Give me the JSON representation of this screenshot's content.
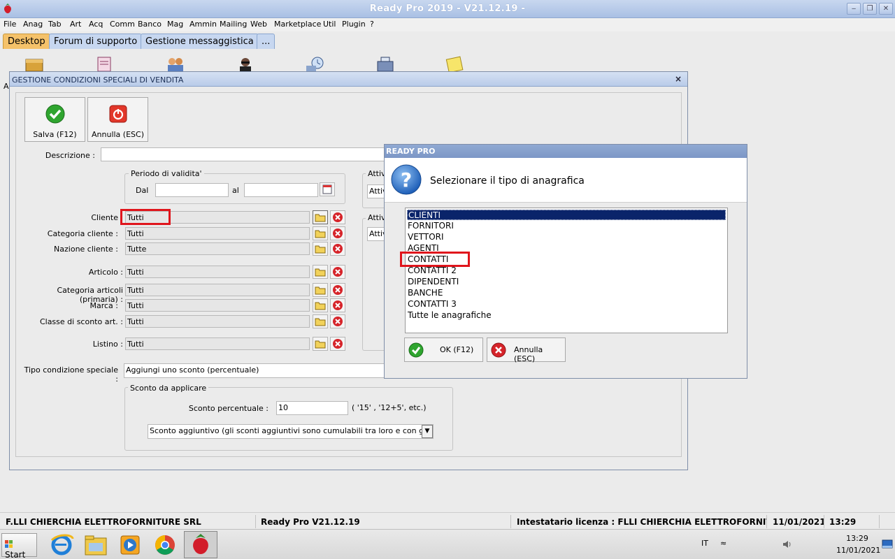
{
  "app": {
    "title": "Ready Pro 2019 - V21.12.19 -",
    "controls": {
      "minimize": "‒",
      "restore": "❐",
      "close": "✕"
    }
  },
  "menu": [
    "File",
    "Anag",
    "Tab",
    "Art",
    "Acq",
    "Comm",
    "Banco",
    "Mag",
    "Ammin",
    "Mailing",
    "Web",
    "Marketplace",
    "Util",
    "Plugin",
    "?"
  ],
  "tabs": [
    {
      "label": "Desktop",
      "active": true
    },
    {
      "label": "Forum di supporto",
      "active": false
    },
    {
      "label": "Gestione messaggistica",
      "active": false
    },
    {
      "label": "...",
      "active": false
    }
  ],
  "desktop": {
    "partial_letter": "A"
  },
  "main_window": {
    "title": "GESTIONE CONDIZIONI SPECIALI DI VENDITA",
    "close": "×",
    "save_button": "Salva (F12)",
    "cancel_button": "Annulla (ESC)",
    "descrizione_label": "Descrizione :",
    "descrizione_value": "",
    "periodo": {
      "title": "Periodo di validita'",
      "dal_label": "Dal",
      "al_label": "al",
      "dal_value": "",
      "al_value": ""
    },
    "attiv_label_1": "Attiv",
    "attiv_value_1": "Attiv",
    "attiv_label_2": "Attiv",
    "attiv_value_2": "Attiv",
    "fields": [
      {
        "label": "Cliente",
        "value": "Tutti"
      },
      {
        "label": "Categoria cliente :",
        "value": "Tutti"
      },
      {
        "label": "Nazione cliente :",
        "value": "Tutte"
      },
      {
        "label": "Articolo :",
        "value": "Tutti"
      },
      {
        "label": "Categoria articoli (primaria) :",
        "value": "Tutti"
      },
      {
        "label": "Marca :",
        "value": "Tutti"
      },
      {
        "label": "Classe di sconto art. :",
        "value": "Tutti"
      },
      {
        "label": "Listino :",
        "value": "Tutti"
      }
    ],
    "tipo_condizione_label": "Tipo condizione speciale :",
    "tipo_condizione_value": "Aggiungi uno sconto (percentuale)",
    "sconto": {
      "title": "Sconto da applicare",
      "percent_label": "Sconto percentuale :",
      "percent_value": "10",
      "hint": "( '15' ,  '12+5', etc.)",
      "type_value": "Sconto aggiuntivo (gli sconti aggiuntivi sono cumulabili tra loro e con gli sconti prin",
      "dropdown_arrow": "▼"
    }
  },
  "popup": {
    "title": "READY PRO",
    "message": "Selezionare il tipo di anagrafica",
    "items": [
      "CLIENTI",
      "FORNITORI",
      "VETTORI",
      "AGENTI",
      "CONTATTI",
      "CONTATTI 2",
      "DIPENDENTI",
      "BANCHE",
      "CONTATTI 3",
      "Tutte le anagrafiche"
    ],
    "selected_index": 0,
    "ok_button": "OK (F12)",
    "cancel_button": "Annulla (ESC)"
  },
  "statusbar": {
    "company": "F.LLI CHIERCHIA ELETTROFORNITURE SRL",
    "version": "Ready Pro V21.12.19",
    "license": "Intestatario licenza : FLLI CHIERCHIA ELETTROFORNITURE S",
    "date": "11/01/2021",
    "time": "13:29"
  },
  "taskbar": {
    "start": "Start",
    "lang": "IT",
    "tray_up": "≈",
    "clock_time": "13:29",
    "clock_date": "11/01/2021",
    "apps": [
      "ie-icon",
      "file-explorer-icon",
      "media-player-icon",
      "chrome-icon",
      "strawberry-icon"
    ]
  },
  "colors": {
    "accent_tab": "#f5c26a",
    "selection": "#0a246a",
    "highlight_box": "#e0151c"
  }
}
